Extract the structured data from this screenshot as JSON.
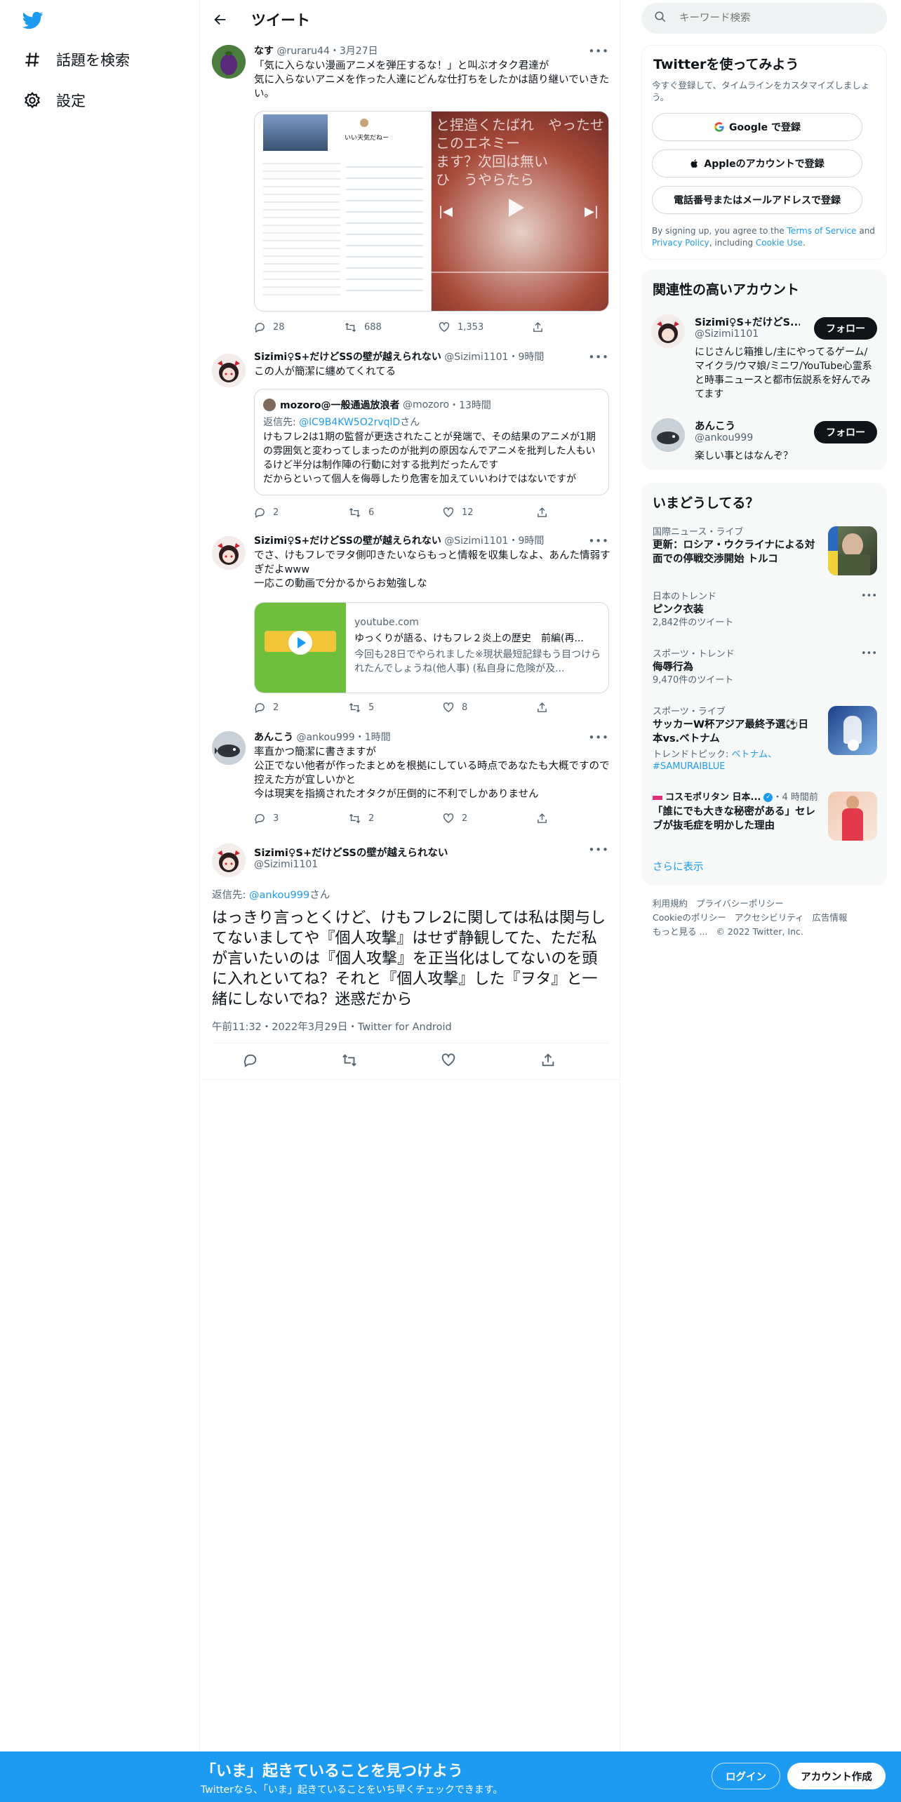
{
  "nav": {
    "explore_label": "話題を検索",
    "settings_label": "設定"
  },
  "header": {
    "title": "ツイート"
  },
  "tweets": [
    {
      "name": "なす",
      "handle": "@ruraru44",
      "time": "3月27日",
      "text": "「気に入らない漫画アニメを弾圧するな！」と叫ぶオタク君達が\n気に入らないアニメを作った人達にどんな仕打ちをしたかは語り継いでいきたい。",
      "replies": "28",
      "retweets": "688",
      "likes": "1,353",
      "media_left_text": "いい天気だねー",
      "media_right_text": "と捏造くたばれ　やったせ\nこのエネミー\nます？次回は無い\nひ　うやらたら"
    },
    {
      "name": "Sizimi♀S+だけどSSの壁が越えられない",
      "handle": "@Sizimi1101",
      "time": "9時間",
      "text": "この人が簡潔に纏めてくれてる",
      "replies": "2",
      "retweets": "6",
      "likes": "12",
      "quote": {
        "name": "mozoro@一般通過放浪者",
        "handle": "@mozoro",
        "time": "13時間",
        "reply_prefix": "返信先: ",
        "reply_to": "@lC9B4KW5O2rvqlD",
        "reply_suffix": "さん",
        "text": "けもフレ2は1期の監督が更迭されたことが発端で、その結果のアニメが1期の雰囲気と変わってしまったのが批判の原因なんでアニメを批判した人もいるけど半分は制作陣の行動に対する批判だったんです\nだからといって個人を侮辱したり危害を加えていいわけではないですが"
      }
    },
    {
      "name": "Sizimi♀S+だけどSSの壁が越えられない",
      "handle": "@Sizimi1101",
      "time": "9時間",
      "text": "でさ、けもフレでヲタ側叩きたいならもっと情報を収集しなよ、あんた情弱すぎだよwww\n一応この動画で分かるからお勉強しな",
      "replies": "2",
      "retweets": "5",
      "likes": "8",
      "card": {
        "domain": "youtube.com",
        "title": "ゆっくりが語る、けもフレ２炎上の歴史　前編(再...",
        "desc": "今回も28日でやられました※現状最短記録もう目つけられたんでしょうね(他人事) (私自身に危険が及..."
      }
    },
    {
      "name": "あんこう",
      "handle": "@ankou999",
      "time": "1時間",
      "text": "率直かつ簡潔に書きますが\n公正でない他者が作ったまとめを根拠にしている時点であなたも大概ですので控えた方が宜しいかと\n今は現実を指摘されたオタクが圧倒的に不利でしかありません",
      "replies": "3",
      "retweets": "2",
      "likes": "2"
    }
  ],
  "main_tweet": {
    "name": "Sizimi♀S+だけどSSの壁が越えられない",
    "handle": "@Sizimi1101",
    "reply_prefix": "返信先: ",
    "reply_to": "@ankou999",
    "reply_suffix": "さん",
    "text": "はっきり言っとくけど、けもフレ2に関しては私は関与してないましてや『個人攻撃』はせず静観してた、ただ私が言いたいのは『個人攻撃』を正当化はしてないのを頭に入れといてね？それと『個人攻撃』した『ヲタ』と一緒にしないでね？迷惑だから",
    "meta": "午前11:32・2022年3月29日・Twitter for Android"
  },
  "search": {
    "placeholder": "キーワード検索"
  },
  "signup_panel": {
    "title": "Twitterを使ってみよう",
    "subtitle": "今すぐ登録して、タイムラインをカスタマイズしましょう。",
    "google_label": "Google で登録",
    "apple_label": "Appleのアカウントで登録",
    "phone_label": "電話番号またはメールアドレスで登録",
    "terms_prefix": "By signing up, you agree to the ",
    "terms_link": "Terms of Service",
    "terms_and": " and ",
    "privacy_link": "Privacy Policy",
    "terms_including": ", including ",
    "cookie_link": "Cookie Use",
    "terms_end": "."
  },
  "related_panel": {
    "title": "関連性の高いアカウント",
    "accounts": [
      {
        "name": "Sizimi♀S+だけどS...",
        "handle": "@Sizimi1101",
        "bio": "にじさんじ箱推し/主にやってるゲーム/マイクラ/ウマ娘/ミニワ/YouTube心霊系と時事ニュースと都市伝説系を好んでみてます",
        "follow_label": "フォロー"
      },
      {
        "name": "あんこう",
        "handle": "@ankou999",
        "bio": "楽しい事とはなんぞ？",
        "follow_label": "フォロー"
      }
    ]
  },
  "trends_panel": {
    "title": "いまどうしてる？",
    "items": [
      {
        "meta": "国際ニュース・ライブ",
        "title": "更新：ロシア・ウクライナによる対面での停戦交渉開始 トルコ"
      },
      {
        "meta": "日本のトレンド",
        "title": "ピンク衣装",
        "count": "2,842件のツイート"
      },
      {
        "meta": "スポーツ・トレンド",
        "title": "侮辱行為",
        "count": "9,470件のツイート"
      },
      {
        "meta": "スポーツ・ライブ",
        "title": "サッカーW杯アジア最終予選⚽日本vs.ベトナム",
        "topic_prefix": "トレンドトピック: ",
        "topic": "ベトナム、#SAMURAIBLUE"
      },
      {
        "meta": "コスモポリタン 日本...",
        "time": "・4 時間前",
        "title": "「誰にでも大きな秘密がある」セレブが抜毛症を明かした理由"
      }
    ],
    "show_more": "さらに表示"
  },
  "footer": {
    "links": [
      "利用規約",
      "プライバシーポリシー",
      "Cookieのポリシー",
      "アクセシビリティ",
      "広告情報",
      "もっと見る ...",
      "© 2022 Twitter, Inc."
    ]
  },
  "bottom_bar": {
    "title": "「いま」起きていることを見つけよう",
    "subtitle": "Twitterなら、「いま」起きていることをいち早くチェックできます。",
    "login_label": "ログイン",
    "signup_label": "アカウント作成"
  },
  "colors": {
    "accent": "#1d9bf0",
    "text": "#0f1419",
    "secondary": "#536471",
    "border": "#cfd9de"
  }
}
